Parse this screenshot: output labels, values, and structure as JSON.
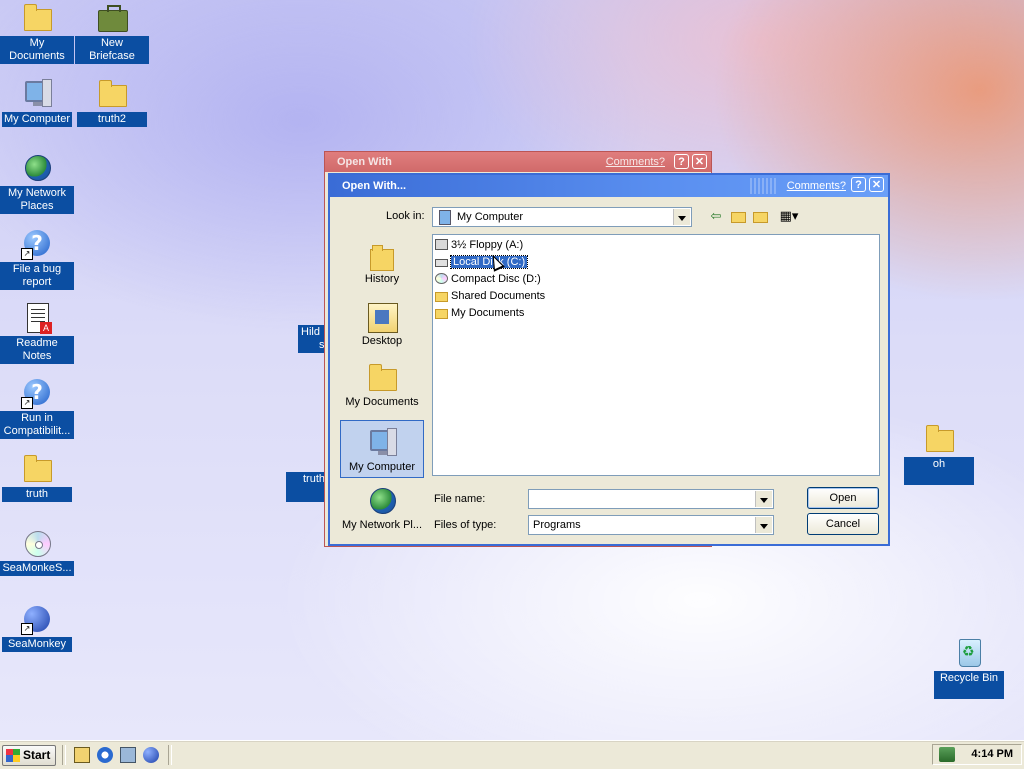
{
  "desktop": {
    "icons": [
      {
        "label": "My Documents"
      },
      {
        "label": "New Briefcase"
      },
      {
        "label": "My Computer"
      },
      {
        "label": "truth2"
      },
      {
        "label": "My Network Places"
      },
      {
        "label": "File a bug report"
      },
      {
        "label": "Readme Notes"
      },
      {
        "label": "Run in Compatibilit..."
      },
      {
        "label": "truth"
      },
      {
        "label": "SeaMonkeS..."
      },
      {
        "label": "SeaMonkey"
      },
      {
        "label": "oh"
      },
      {
        "label": "Recycle Bin"
      }
    ],
    "partial": {
      "hild": "Hild",
      "s": "s",
      "truth": "truth"
    }
  },
  "back_window": {
    "title": "Open With",
    "comments": "Comments?",
    "help": "?",
    "close": "✕"
  },
  "dialog": {
    "title": "Open With...",
    "comments": "Comments?",
    "help": "?",
    "close": "✕",
    "look_in_label": "Look in:",
    "look_in_value": "My Computer",
    "places": [
      {
        "label": "History"
      },
      {
        "label": "Desktop"
      },
      {
        "label": "My Documents"
      },
      {
        "label": "My Computer"
      },
      {
        "label": "My Network Pl..."
      }
    ],
    "files": [
      {
        "name": "3½ Floppy (A:)"
      },
      {
        "name": "Local Disk (C:)"
      },
      {
        "name": "Compact Disc (D:)"
      },
      {
        "name": "Shared Documents"
      },
      {
        "name": "My Documents"
      }
    ],
    "file_name_label": "File name:",
    "file_name_value": "",
    "files_of_type_label": "Files of type:",
    "files_of_type_value": "Programs",
    "open_button": "Open",
    "cancel_button": "Cancel"
  },
  "taskbar": {
    "start_label": "Start",
    "time": "4:14 PM"
  }
}
